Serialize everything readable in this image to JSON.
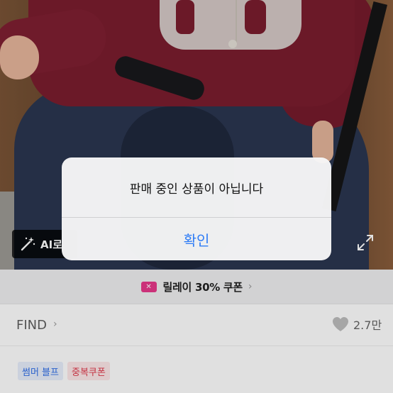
{
  "alert": {
    "message": "판매 중인 상품이 아닙니다",
    "confirm_label": "확인"
  },
  "photo": {
    "ai_chip_label": "AI로",
    "expand_icon": "expand-icon",
    "wand_icon": "magic-wand-icon"
  },
  "coupon": {
    "icon": "coupon-ticket-icon",
    "label": "릴레이 30% 쿠폰",
    "chevron": "›"
  },
  "store": {
    "name": "FIND",
    "chevron": "›",
    "like_count": "2.7만",
    "like_icon": "heart-icon"
  },
  "tags": [
    {
      "label": "썸머 블프"
    },
    {
      "label": "중복쿠폰"
    }
  ],
  "colors": {
    "accent_blue": "#2e7cf6",
    "coupon_pink": "#e8388a",
    "tag_blue": "#2f6ee8",
    "tag_red": "#e0394b"
  }
}
